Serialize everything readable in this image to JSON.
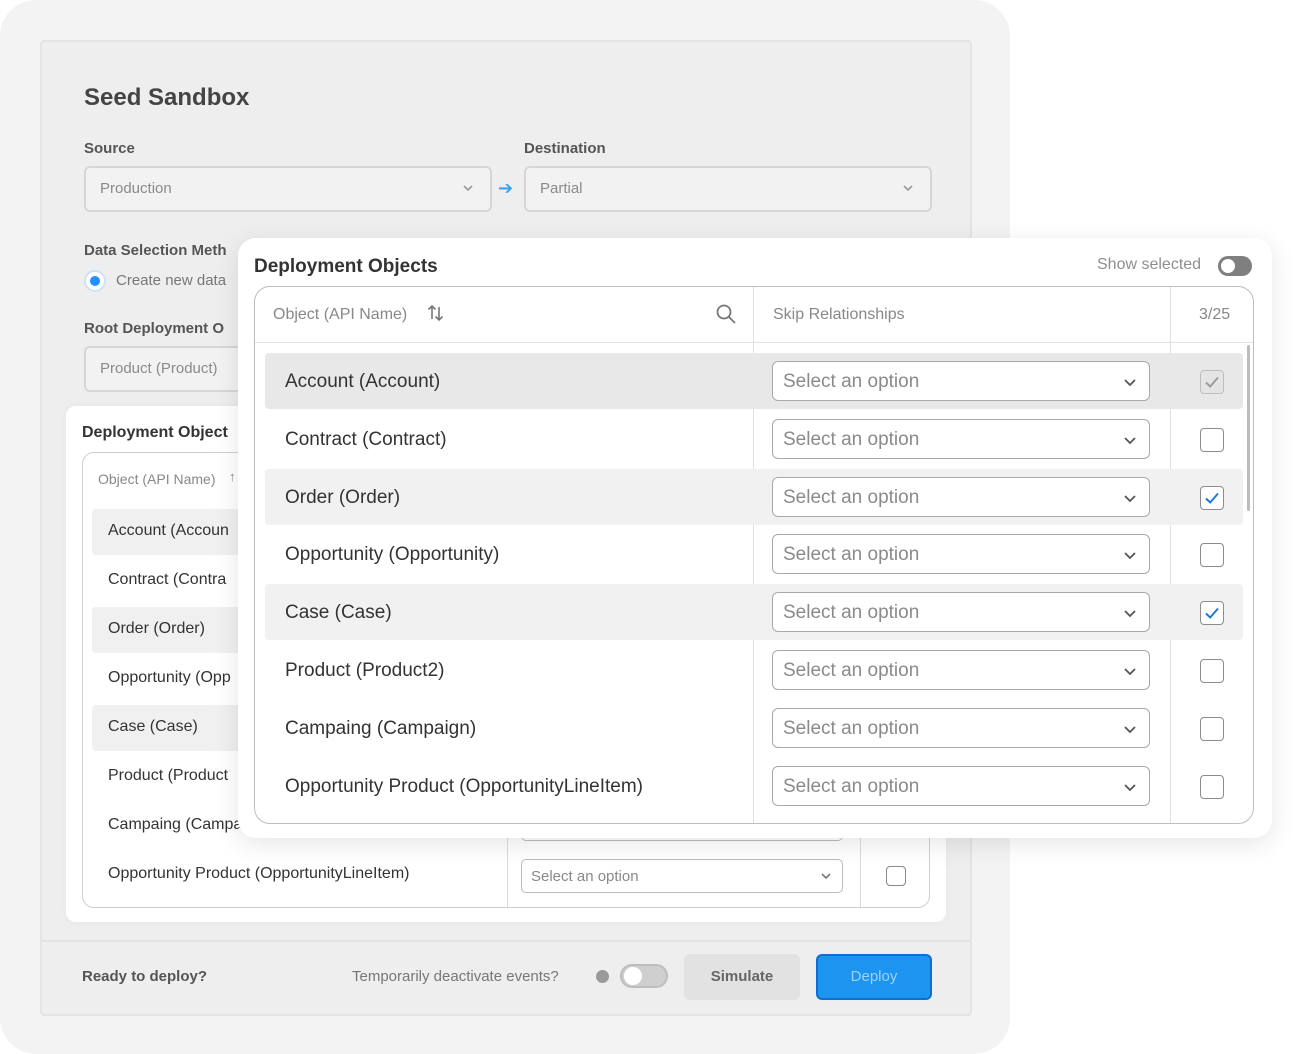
{
  "seed": {
    "title": "Seed Sandbox",
    "source_label": "Source",
    "source_value": "Production",
    "destination_label": "Destination",
    "destination_value": "Partial",
    "data_selection_label": "Data Selection Meth",
    "radio_label": "Create new data",
    "root_label": "Root Deployment O",
    "root_value": "Product (Product)",
    "footer": {
      "ready": "Ready to deploy?",
      "deactivate": "Temporarily deactivate events?",
      "simulate": "Simulate",
      "deploy": "Deploy"
    }
  },
  "mid": {
    "title": "Deployment Object",
    "header_object": "Object (API Name)",
    "header_sort": "↑",
    "rows": [
      "Account (Accoun",
      "Contract (Contra",
      "Order (Order)",
      "Opportunity (Opp",
      "Case (Case)",
      "Product (Product",
      "Campaing (Campa",
      "Opportunity Product (OpportunityLineItem)"
    ],
    "select_placeholder": "Select an option"
  },
  "front": {
    "title": "Deployment Objects",
    "show_selected": "Show selected",
    "header_object": "Object (API Name)",
    "header_skip": "Skip Relationships",
    "header_count": "3/25",
    "select_placeholder": "Select an option",
    "rows": [
      {
        "name": "Account (Account)",
        "checked": true,
        "disabled": true
      },
      {
        "name": "Contract (Contract)",
        "checked": false,
        "disabled": false
      },
      {
        "name": "Order (Order)",
        "checked": true,
        "disabled": false
      },
      {
        "name": "Opportunity (Opportunity)",
        "checked": false,
        "disabled": false
      },
      {
        "name": "Case (Case)",
        "checked": true,
        "disabled": false
      },
      {
        "name": "Product (Product2)",
        "checked": false,
        "disabled": false
      },
      {
        "name": "Campaing (Campaign)",
        "checked": false,
        "disabled": false
      },
      {
        "name": "Opportunity Product (OpportunityLineItem)",
        "checked": false,
        "disabled": false
      }
    ]
  },
  "colors": {
    "accent": "#1e90ff",
    "check": "#1877d6",
    "check_disabled": "#9a9a9a"
  }
}
